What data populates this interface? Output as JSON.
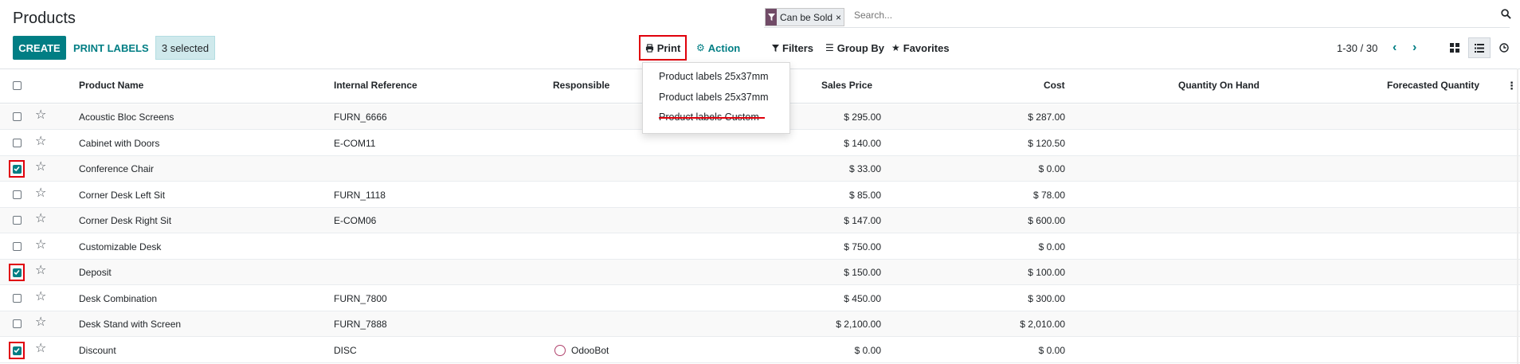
{
  "header": {
    "title": "Products"
  },
  "toolbar": {
    "create_label": "CREATE",
    "print_labels_label": "PRINT LABELS",
    "selected_label": "3 selected",
    "print_label": "Print",
    "action_label": "Action"
  },
  "search": {
    "facet_label": "Can be Sold",
    "facet_close": "×",
    "placeholder": "Search..."
  },
  "filters": {
    "filters_label": "Filters",
    "groupby_label": "Group By",
    "favorites_label": "Favorites"
  },
  "pager": {
    "text": "1-30 / 30"
  },
  "print_menu": {
    "items": [
      "Product labels 25x37mm",
      "Product labels 25x37mm",
      "Product labels Custom"
    ]
  },
  "table": {
    "columns": [
      "Product Name",
      "Internal Reference",
      "Responsible",
      "Sales Price",
      "Cost",
      "Quantity On Hand",
      "Forecasted Quantity"
    ],
    "rows": [
      {
        "name": "Acoustic Bloc Screens",
        "ref": "FURN_6666",
        "responsible": "",
        "price": "$ 295.00",
        "cost": "$ 287.00",
        "selected": false
      },
      {
        "name": "Cabinet with Doors",
        "ref": "E-COM11",
        "responsible": "",
        "price": "$ 140.00",
        "cost": "$ 120.50",
        "selected": false
      },
      {
        "name": "Conference Chair",
        "ref": "",
        "responsible": "",
        "price": "$ 33.00",
        "cost": "$ 0.00",
        "selected": true
      },
      {
        "name": "Corner Desk Left Sit",
        "ref": "FURN_1118",
        "responsible": "",
        "price": "$ 85.00",
        "cost": "$ 78.00",
        "selected": false
      },
      {
        "name": "Corner Desk Right Sit",
        "ref": "E-COM06",
        "responsible": "",
        "price": "$ 147.00",
        "cost": "$ 600.00",
        "selected": false
      },
      {
        "name": "Customizable Desk",
        "ref": "",
        "responsible": "",
        "price": "$ 750.00",
        "cost": "$ 0.00",
        "selected": false
      },
      {
        "name": "Deposit",
        "ref": "",
        "responsible": "",
        "price": "$ 150.00",
        "cost": "$ 100.00",
        "selected": true
      },
      {
        "name": "Desk Combination",
        "ref": "FURN_7800",
        "responsible": "",
        "price": "$ 450.00",
        "cost": "$ 300.00",
        "selected": false
      },
      {
        "name": "Desk Stand with Screen",
        "ref": "FURN_7888",
        "responsible": "",
        "price": "$ 2,100.00",
        "cost": "$ 2,010.00",
        "selected": false
      },
      {
        "name": "Discount",
        "ref": "DISC",
        "responsible": "OdooBot",
        "price": "$ 0.00",
        "cost": "$ 0.00",
        "selected": true
      }
    ]
  },
  "colors": {
    "accent": "#017e84",
    "highlight": "#e0000b",
    "facet": "#714b67"
  }
}
